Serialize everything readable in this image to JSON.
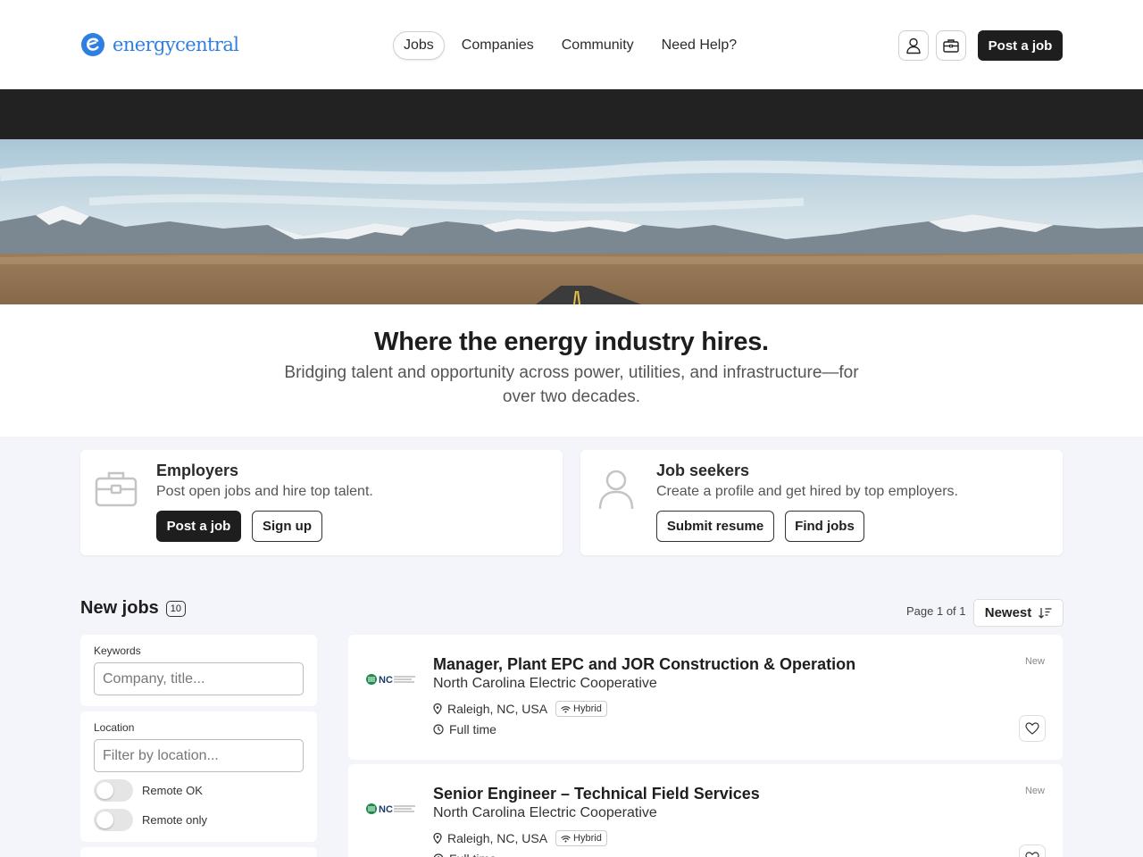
{
  "brand": {
    "name": "energycentral",
    "color": "#2f7fe0"
  },
  "header": {
    "nav": [
      "Jobs",
      "Companies",
      "Community",
      "Need Help?"
    ],
    "active_nav": "Jobs",
    "post_job_label": "Post a job"
  },
  "hero": {
    "title": "Where the energy industry hires.",
    "subtitle": "Bridging talent and opportunity across power, utilities, and infrastructure—for over two decades."
  },
  "employers": {
    "title": "Employers",
    "description": "Post open jobs and hire top talent.",
    "primary_label": "Post a job",
    "secondary_label": "Sign up"
  },
  "seekers": {
    "title": "Job seekers",
    "description": "Create a profile and get hired by top employers.",
    "primary_label": "Submit resume",
    "secondary_label": "Find jobs"
  },
  "jobs_section": {
    "title": "New jobs",
    "count": "10",
    "page_info": "Page 1 of 1",
    "sort_label": "Newest"
  },
  "filters": {
    "keywords_label": "Keywords",
    "keywords_placeholder": "Company, title...",
    "location_label": "Location",
    "location_placeholder": "Filter by location...",
    "remote_ok_label": "Remote OK",
    "remote_only_label": "Remote only"
  },
  "jobs": [
    {
      "title": "Manager, Plant EPC and JOR Construction & Operation",
      "company": "North Carolina Electric Cooperative",
      "location": "Raleigh, NC, USA",
      "work_mode": "Hybrid",
      "employment_type": "Full time",
      "tag": "New",
      "logo_text": "NC"
    },
    {
      "title": "Senior Engineer – Technical Field Services",
      "company": "North Carolina Electric Cooperative",
      "location": "Raleigh, NC, USA",
      "work_mode": "Hybrid",
      "employment_type": "Full time",
      "tag": "New",
      "logo_text": "NC"
    }
  ]
}
